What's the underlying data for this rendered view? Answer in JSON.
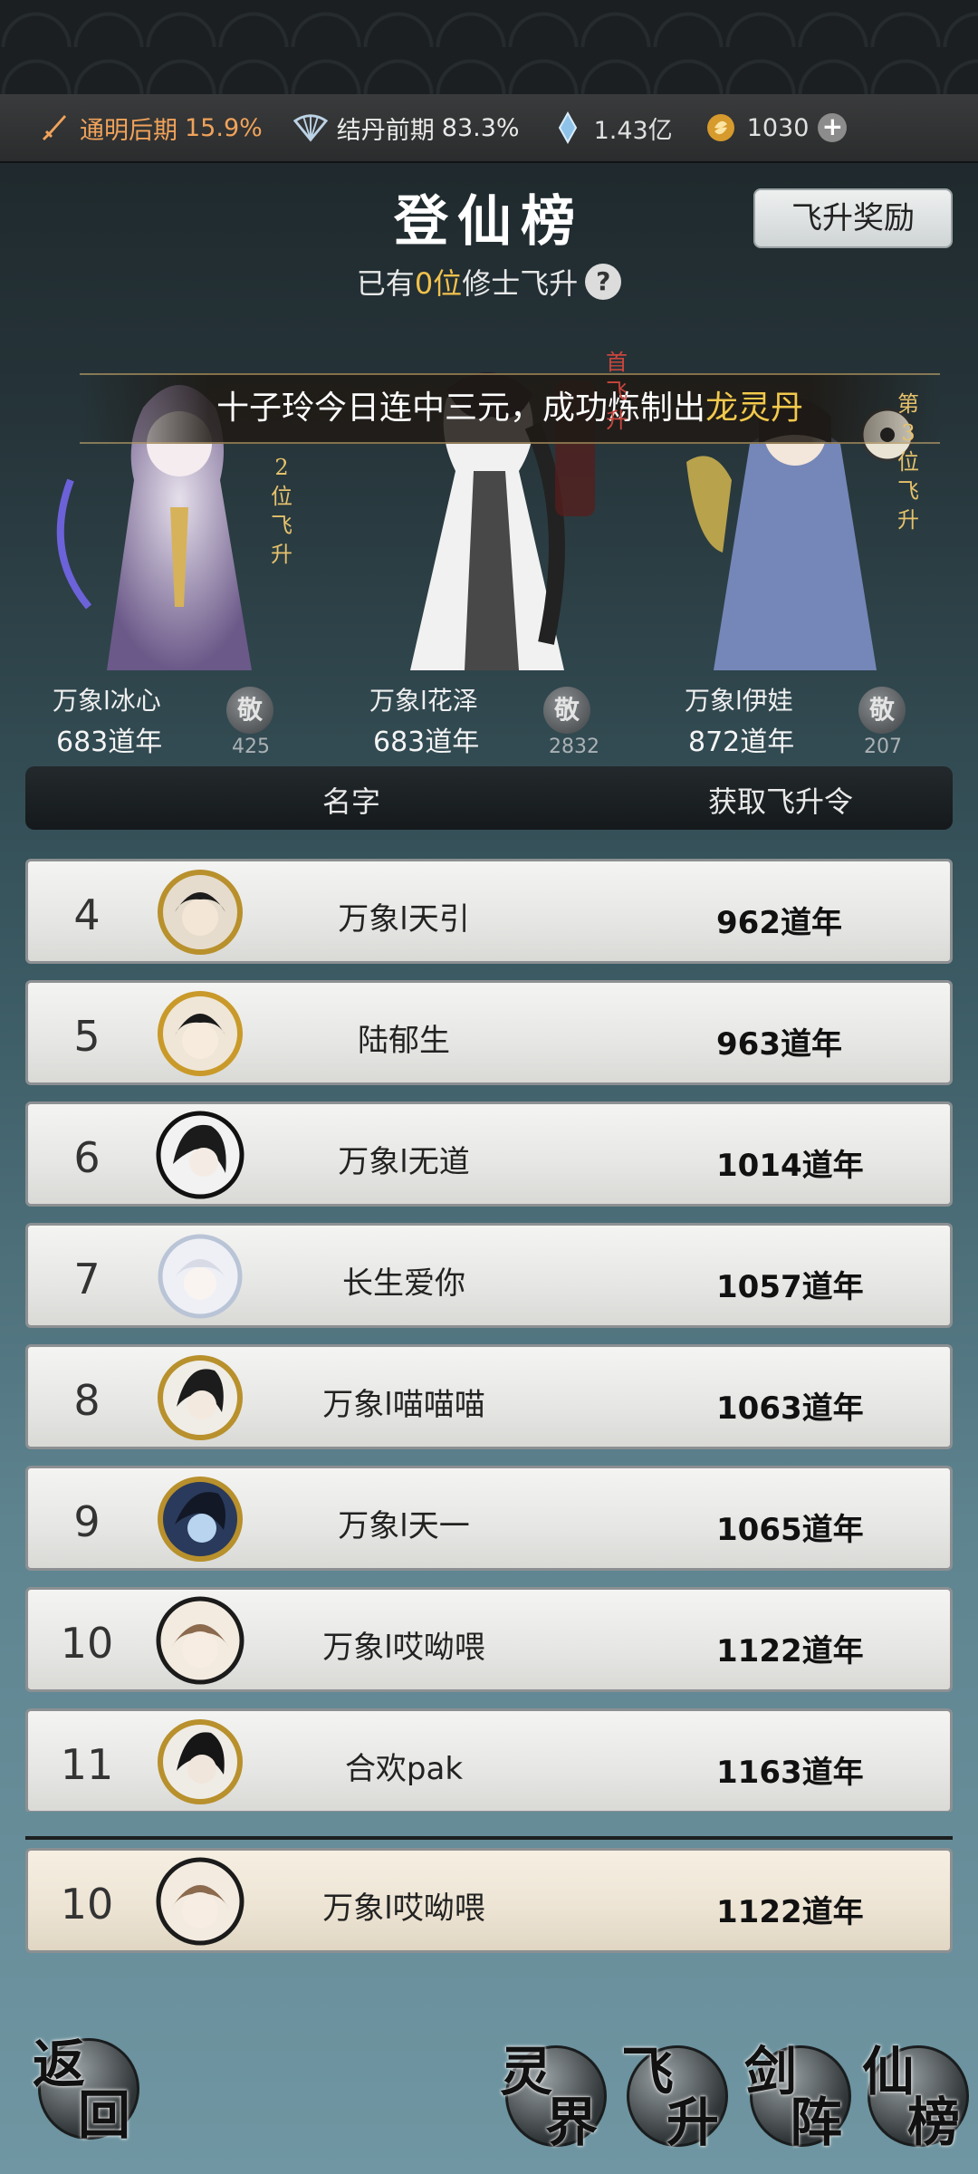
{
  "resources": {
    "realm_main": {
      "label": "通明后期",
      "percent": "15.9%",
      "icon": "sword-icon"
    },
    "realm_sub": {
      "label": "结丹前期",
      "percent": "83.3%",
      "icon": "fan-icon"
    },
    "spirit_stone": {
      "value": "1.43亿",
      "icon": "crystal-icon"
    },
    "currency": {
      "value": "1030",
      "icon": "coin-icon"
    }
  },
  "header": {
    "title": "登仙榜",
    "subtitle_prefix": "已有",
    "subtitle_count": "0位",
    "subtitle_suffix": "修士飞升",
    "help_label": "?",
    "reward_button": "飞升奖励"
  },
  "announcement": {
    "prefix": "十子玲今日连中三元，成功炼制出",
    "highlight": "龙灵丹"
  },
  "podium": [
    {
      "tag": "2位飞升",
      "name": "万象l冰心",
      "years": "683道年",
      "respect_label": "敬",
      "respect_count": "425"
    },
    {
      "tag": "首飞升",
      "name": "万象l花泽",
      "years": "683道年",
      "respect_label": "敬",
      "respect_count": "2832"
    },
    {
      "tag": "第3位飞升",
      "name": "万象l伊娃",
      "years": "872道年",
      "respect_label": "敬",
      "respect_count": "207"
    }
  ],
  "table_header": {
    "name": "名字",
    "token": "获取飞升令"
  },
  "rows": [
    {
      "rank": "4",
      "name": "万象l天引",
      "years": "962道年"
    },
    {
      "rank": "5",
      "name": "陆郁生",
      "years": "963道年"
    },
    {
      "rank": "6",
      "name": "万象l无道",
      "years": "1014道年"
    },
    {
      "rank": "7",
      "name": "长生爱你",
      "years": "1057道年"
    },
    {
      "rank": "8",
      "name": "万象l喵喵喵",
      "years": "1063道年"
    },
    {
      "rank": "9",
      "name": "万象l天一",
      "years": "1065道年"
    },
    {
      "rank": "10",
      "name": "万象l哎呦喂",
      "years": "1122道年"
    },
    {
      "rank": "11",
      "name": "合欢pak",
      "years": "1163道年"
    }
  ],
  "self_row": {
    "rank": "10",
    "name": "万象l哎呦喂",
    "years": "1122道年"
  },
  "bottom_nav": {
    "back": [
      "返",
      "回"
    ],
    "tabs": [
      [
        "灵",
        "界"
      ],
      [
        "飞",
        "升"
      ],
      [
        "剑",
        "阵"
      ],
      [
        "仙",
        "榜"
      ]
    ]
  },
  "colors": {
    "accent_orange": "#f0a35b",
    "accent_gold": "#f2c94c",
    "row_bg": "#e8e8e6"
  }
}
